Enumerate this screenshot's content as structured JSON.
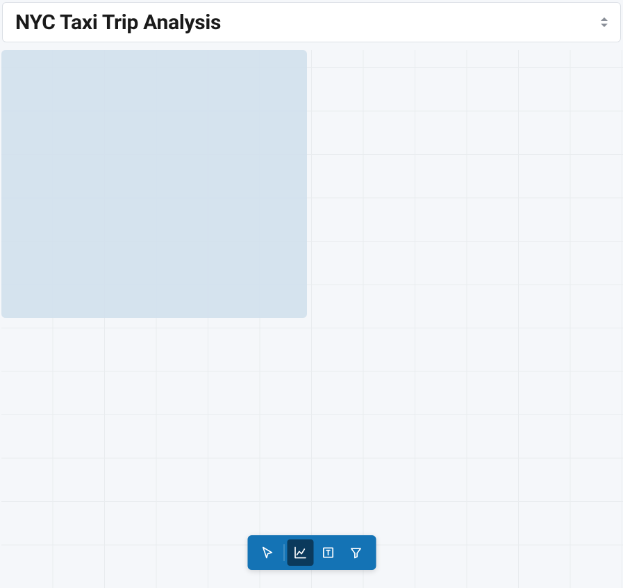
{
  "header": {
    "title": "NYC Taxi Trip Analysis"
  },
  "toolbar": {
    "tools": [
      {
        "name": "pointer",
        "icon": "cursor",
        "active": false
      },
      {
        "name": "chart",
        "icon": "line-chart",
        "active": true
      },
      {
        "name": "text",
        "icon": "text-box",
        "active": false
      },
      {
        "name": "filter",
        "icon": "filter",
        "active": false
      }
    ]
  },
  "canvas": {
    "placeholder_visible": true
  }
}
